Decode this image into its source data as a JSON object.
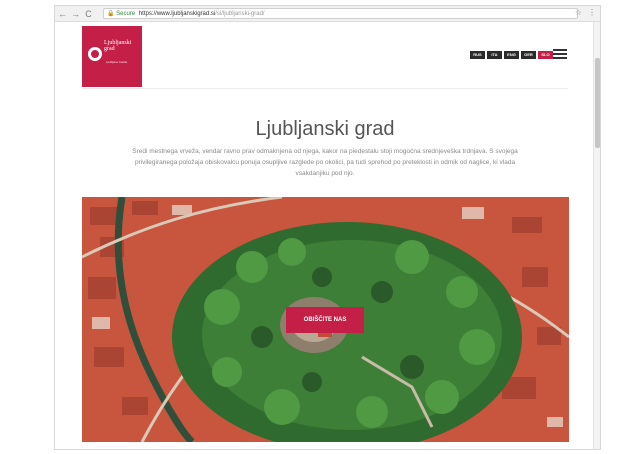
{
  "browser": {
    "back": "←",
    "forward": "→",
    "reload": "C",
    "lock": "🔒",
    "secure_label": "Secure",
    "url_host": "https://www.ljubljanskigrad.si",
    "url_path": "/sl/ljubljanski-grad/",
    "star": "☆",
    "menu": "⋮"
  },
  "logo": {
    "title": "Ljubljanski grad",
    "subtitle": "Ljubljana Castle"
  },
  "languages": [
    {
      "label": "RUS"
    },
    {
      "label": "ITA"
    },
    {
      "label": "ENG"
    },
    {
      "label": "GER"
    },
    {
      "label": "SLO",
      "active": true
    }
  ],
  "main": {
    "title": "Ljubljanski grad",
    "lead": "Sredi mestnega vrveža, vendar ravno prav odmaknjena od njega, kakor na piedestalu stoji mogočna srednjeveška trdnjava. S svojega privilegiranega položaja obiskovalcu ponuja osupljive razglede po okolici, pa tudi sprehod po preteklosti in odmik od naglice, ki vlada vsakdanjiku pod njo.",
    "cta_label": "OBIŠČITE NAS"
  },
  "colors": {
    "brand": "#c41f47",
    "dark": "#2b2b2b"
  }
}
